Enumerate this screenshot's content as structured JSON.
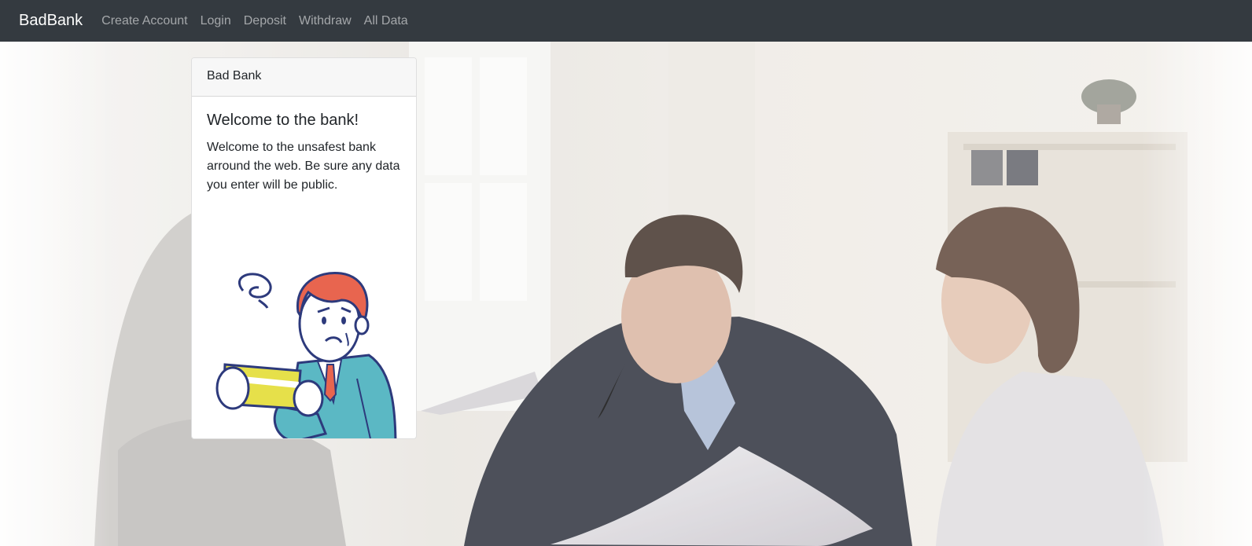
{
  "navbar": {
    "brand": "BadBank",
    "links": [
      "Create Account",
      "Login",
      "Deposit",
      "Withdraw",
      "All Data"
    ]
  },
  "card": {
    "header": "Bad Bank",
    "title": "Welcome to the bank!",
    "text": "Welcome to the unsafest bank arround the web. Be sure any data you enter will be public."
  },
  "colors": {
    "navbar_bg": "#343a40",
    "suit": "#5bb8c4",
    "hair": "#e8654f",
    "card_item": "#e6e04a",
    "outline": "#2d3a7c"
  },
  "icons": {
    "illustration": "worried-man-holding-card",
    "background": "frustrated-couple-photo"
  }
}
